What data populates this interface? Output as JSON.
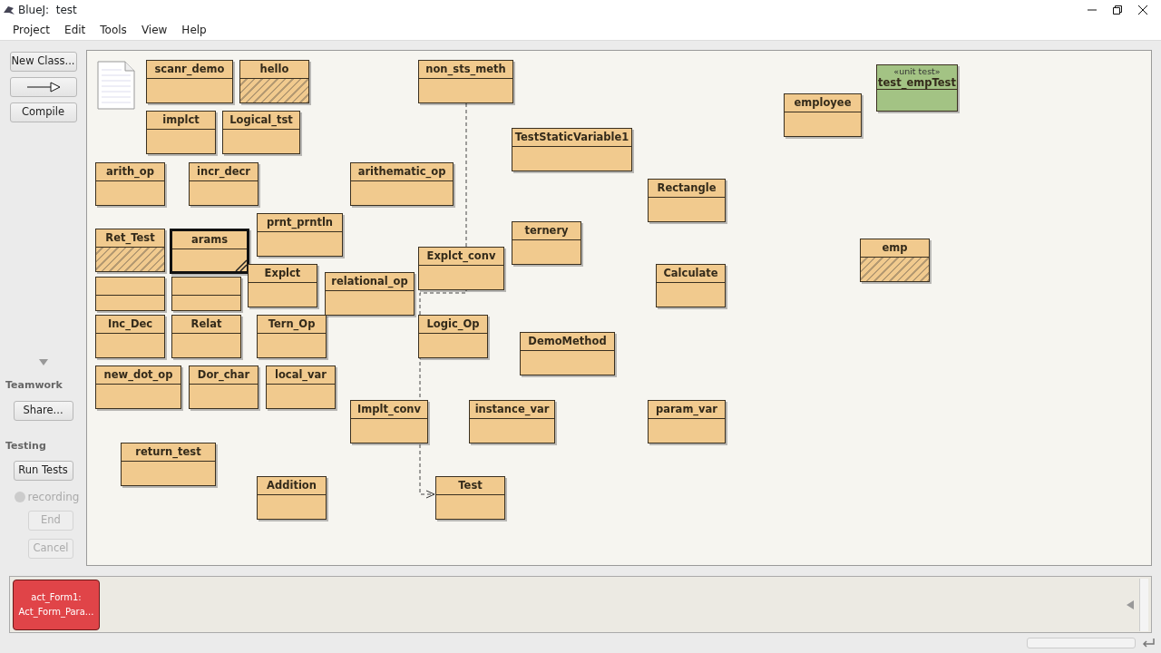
{
  "window": {
    "title": "BlueJ:  test"
  },
  "menu": [
    "Project",
    "Edit",
    "Tools",
    "View",
    "Help"
  ],
  "toolbar": [
    {
      "kind": "text",
      "label": "New Class...",
      "disabled": false
    },
    {
      "kind": "arrow",
      "disabled": false
    },
    {
      "kind": "text",
      "label": "Compile",
      "disabled": false
    }
  ],
  "teamwork": {
    "title": "Teamwork",
    "buttons": [
      {
        "label": "Share...",
        "disabled": false
      }
    ]
  },
  "testing": {
    "title": "Testing",
    "run": {
      "label": "Run Tests",
      "disabled": false
    },
    "recording": {
      "label": "recording",
      "on": false
    },
    "buttons": [
      {
        "label": "End",
        "disabled": true
      },
      {
        "label": "Cancel",
        "disabled": true
      }
    ]
  },
  "diagram": {
    "classes": [
      {
        "name": "scanr_demo",
        "kind": "class",
        "compiled": true,
        "selected": false
      },
      {
        "name": "hello",
        "kind": "class",
        "compiled": false,
        "selected": false
      },
      {
        "name": "implct",
        "kind": "class",
        "compiled": true,
        "selected": false
      },
      {
        "name": "Logical_tst",
        "kind": "class",
        "compiled": true,
        "selected": false
      },
      {
        "name": "non_sts_meth",
        "kind": "class",
        "compiled": true,
        "selected": false
      },
      {
        "name": "TestStaticVariable1",
        "kind": "class",
        "compiled": true,
        "selected": false
      },
      {
        "name": "test_empTest",
        "stereotype": "«unit test»",
        "kind": "test",
        "compiled": true,
        "selected": false
      },
      {
        "name": "employee",
        "kind": "class",
        "compiled": true,
        "selected": false
      },
      {
        "name": "arith_op",
        "kind": "class",
        "compiled": true,
        "selected": false
      },
      {
        "name": "incr_decr",
        "kind": "class",
        "compiled": true,
        "selected": false
      },
      {
        "name": "arithematic_op",
        "kind": "class",
        "compiled": true,
        "selected": false
      },
      {
        "name": "Rectangle",
        "kind": "class",
        "compiled": true,
        "selected": false
      },
      {
        "name": "prnt_prntln",
        "kind": "class",
        "compiled": true,
        "selected": false
      },
      {
        "name": "ternery",
        "kind": "class",
        "compiled": true,
        "selected": false
      },
      {
        "name": "emp",
        "kind": "class",
        "compiled": false,
        "selected": false
      },
      {
        "kind": "class",
        "compiled": true,
        "selected": false
      },
      {
        "kind": "class",
        "compiled": true,
        "selected": false
      },
      {
        "name": "arams",
        "kind": "class",
        "compiled": true,
        "selected": true
      },
      {
        "name": "Ret_Test",
        "kind": "class",
        "compiled": false,
        "selected": false
      },
      {
        "name": "Explct",
        "kind": "class",
        "compiled": true,
        "selected": false
      },
      {
        "name": "Explct_conv",
        "kind": "class",
        "compiled": true,
        "selected": false
      },
      {
        "name": "relational_op",
        "kind": "class",
        "compiled": true,
        "selected": false
      },
      {
        "name": "Calculate",
        "kind": "class",
        "compiled": true,
        "selected": false
      },
      {
        "name": "Inc_Dec",
        "kind": "class",
        "compiled": true,
        "selected": false
      },
      {
        "name": "Relat",
        "kind": "class",
        "compiled": true,
        "selected": false
      },
      {
        "name": "Tern_Op",
        "kind": "class",
        "compiled": true,
        "selected": false
      },
      {
        "name": "local_var",
        "kind": "class",
        "compiled": true,
        "selected": false
      },
      {
        "name": "Logic_Op",
        "kind": "class",
        "compiled": true,
        "selected": false
      },
      {
        "name": "DemoMethod",
        "kind": "class",
        "compiled": true,
        "selected": false
      },
      {
        "name": "new_dot_op",
        "kind": "class",
        "compiled": true,
        "selected": false
      },
      {
        "name": "Dor_char",
        "kind": "class",
        "compiled": true,
        "selected": false
      },
      {
        "name": "Implt_conv",
        "kind": "class",
        "compiled": true,
        "selected": false
      },
      {
        "name": "instance_var",
        "kind": "class",
        "compiled": true,
        "selected": false
      },
      {
        "name": "param_var",
        "kind": "class",
        "compiled": true,
        "selected": false
      },
      {
        "name": "return_test",
        "kind": "class",
        "compiled": true,
        "selected": false
      },
      {
        "name": "Addition",
        "kind": "class",
        "compiled": true,
        "selected": false
      },
      {
        "name": "Test",
        "kind": "class",
        "compiled": true,
        "selected": false
      }
    ]
  },
  "object_bench": {
    "objects": [
      {
        "label": "act_Form1:",
        "type": "Act_Form_Para..."
      }
    ]
  }
}
